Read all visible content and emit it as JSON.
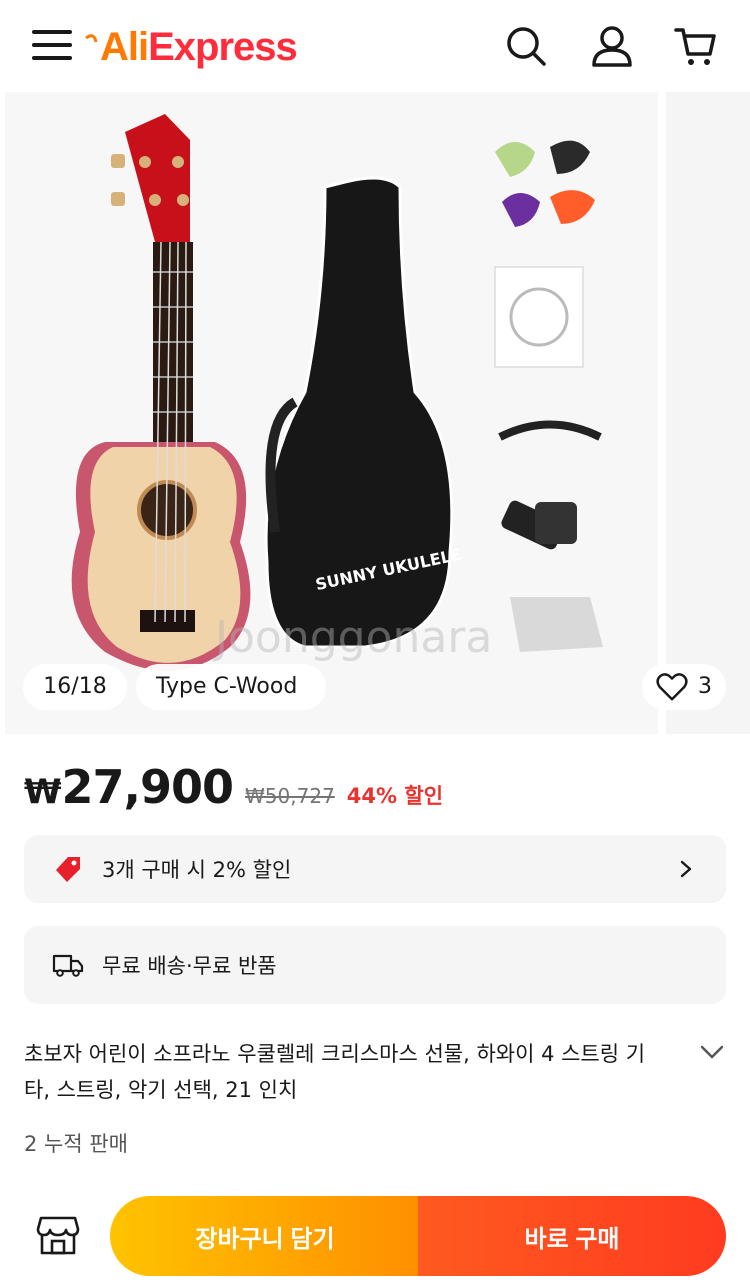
{
  "header": {
    "logo_prefix": "Ali",
    "logo_suffix": "Express",
    "brand_color": "#ff2c3b",
    "icons": [
      "menu-icon",
      "search-icon",
      "user-icon",
      "cart-icon"
    ]
  },
  "gallery": {
    "counter": "16/18",
    "variant": "Type C-Wood",
    "likes": "3",
    "bag_print": "SUNNY UKULELE",
    "watermark": "Joonggonara"
  },
  "price": {
    "currency": "₩",
    "current": "27,900",
    "original": "₩50,727",
    "discount": "44% 할인",
    "discount_color": "#e8332f"
  },
  "promo": {
    "discount_text": "3개 구매 시 2% 할인",
    "shipping_text": "무료 배송·무료 반품"
  },
  "product": {
    "title": "초보자 어린이 소프라노 우쿨렐레 크리스마스 선물, 하와이 4 스트링 기타, 스트링, 악기 선택, 21 인치",
    "sold": "2 누적 판매"
  },
  "actions": {
    "add_to_cart": "장바구니 담기",
    "buy_now": "바로 구매",
    "cart_color": "#ffb000",
    "buy_color": "#ff4a1f"
  }
}
